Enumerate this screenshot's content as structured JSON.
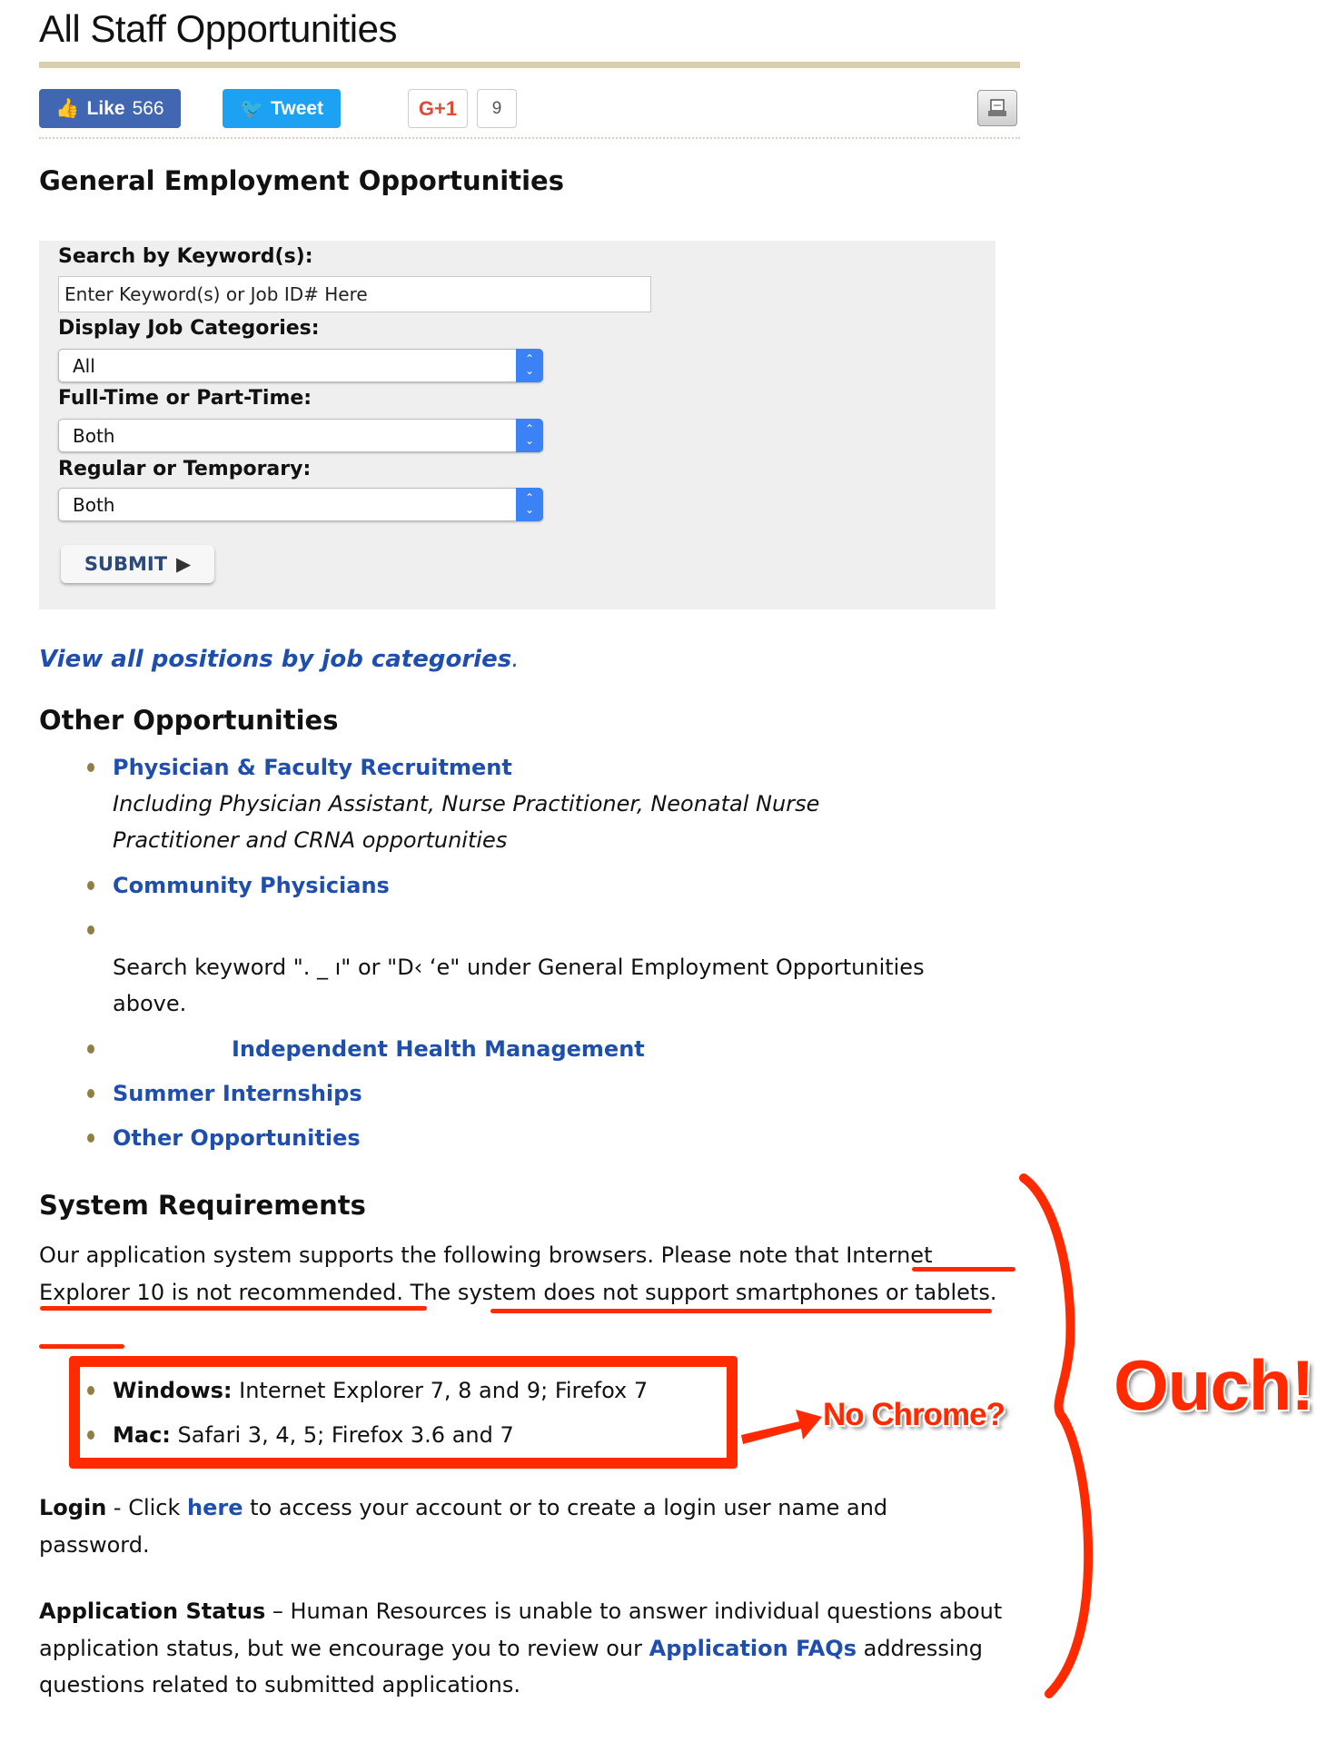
{
  "page": {
    "title": "All Staff Opportunities"
  },
  "social": {
    "like_label": "Like",
    "like_count": "566",
    "tweet_label": "Tweet",
    "gplus_label": "G+1",
    "gplus_count": "9",
    "print_icon": "print-icon"
  },
  "general": {
    "heading": "General Employment Opportunities",
    "keyword_label": "Search by Keyword(s):",
    "keyword_placeholder": "Enter Keyword(s) or Job ID# Here",
    "categories_label": "Display Job Categories:",
    "categories_value": "All",
    "fulltime_label": "Full-Time or Part-Time:",
    "fulltime_value": "Both",
    "regular_label": "Regular or Temporary:",
    "regular_value": "Both",
    "submit_label": "SUBMIT",
    "view_all_link": "View all positions by job categories",
    "view_all_suffix": "."
  },
  "other": {
    "heading": "Other Opportunities",
    "physician_link": "Physician & Faculty Recruitment",
    "physician_desc": "Including Physician Assistant, Nurse Practitioner, Neonatal Nurse Practitioner and CRNA opportunities",
    "community_link": "Community Physicians",
    "search_note": "Search keyword \".          _    ı\" or \"D‹   ʻe\" under General Employment Opportunities above.",
    "ihm_link": "Independent Health Management",
    "summer_link": "Summer Internships",
    "other_link": "Other Opportunities"
  },
  "system": {
    "heading": "System Requirements",
    "intro": "Our application system supports the following browsers. Please note that Internet Explorer 10 is not recommended. The system does not support smartphones or tablets.",
    "windows_label": "Windows:",
    "windows_text": " Internet Explorer 7, 8 and 9; Firefox 7",
    "mac_label": "Mac:",
    "mac_text": " Safari 3, 4, 5; Firefox 3.6 and 7",
    "login_label": "Login",
    "login_pre": " - Click ",
    "login_link": "here",
    "login_post": " to access your account or to create a login user name and password.",
    "status_label": "Application Status",
    "status_pre": " – Human Resources is unable to answer individual questions about application status, but we encourage you to review our ",
    "status_link": "Application FAQs",
    "status_post": " addressing questions related to submitted applications."
  },
  "annotations": {
    "no_chrome": "No Chrome?",
    "ouch": "Ouch!",
    "color": "#ff2a00"
  }
}
